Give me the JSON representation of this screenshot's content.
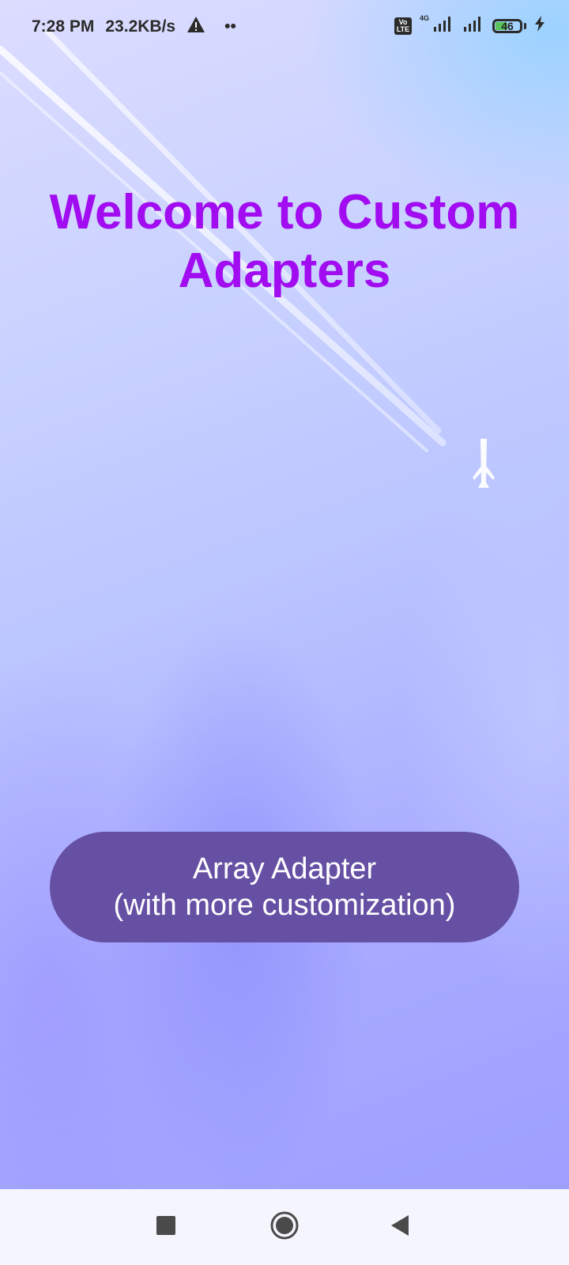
{
  "status_bar": {
    "time": "7:28 PM",
    "net_speed": "23.2KB/s",
    "warning_icon": "warning-triangle-icon",
    "more_dots": "••",
    "volte": "Vo LTE",
    "network_type": "4G",
    "battery_level": "46",
    "battery_color": "#57c35a",
    "charging_icon": "lightning-bolt-icon"
  },
  "main": {
    "title": "Welcome to Custom Adapters",
    "button": {
      "line1": "Array Adapter",
      "line2": "(with more customization)",
      "color": "#6650a4"
    },
    "title_color": "#a10cf0"
  },
  "nav_bar": {
    "recents_icon": "square-icon",
    "home_icon": "circle-icon",
    "back_icon": "triangle-back-icon"
  }
}
